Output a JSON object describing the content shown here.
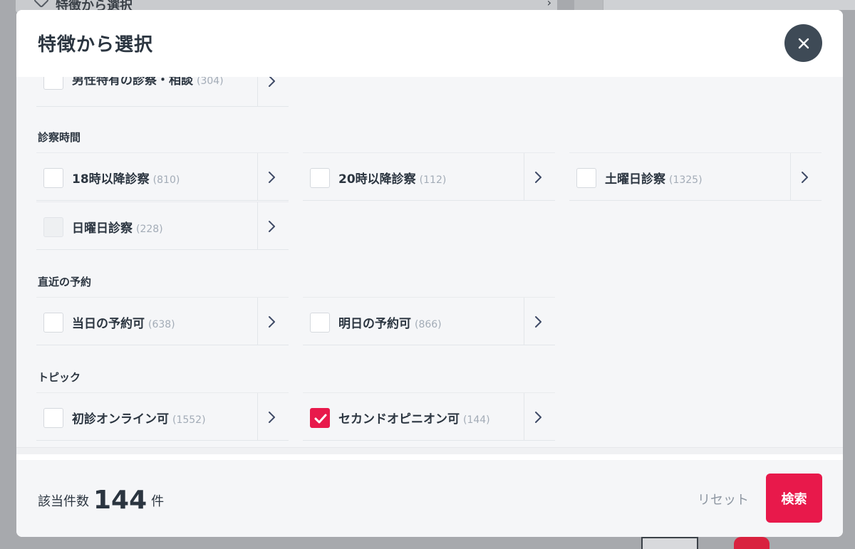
{
  "background": {
    "header_title": "特徴から選択"
  },
  "modal": {
    "title": "特徴から選択",
    "partial_option": {
      "label": "男性特有の診察・相談",
      "count": "(304)"
    },
    "sections": [
      {
        "title": "診察時間",
        "options": [
          {
            "label": "18時以降診察",
            "count": "(810)",
            "state": "unchecked"
          },
          {
            "label": "20時以降診察",
            "count": "(112)",
            "state": "unchecked"
          },
          {
            "label": "土曜日診察",
            "count": "(1325)",
            "state": "unchecked"
          },
          {
            "label": "日曜日診察",
            "count": "(228)",
            "state": "disabled"
          }
        ]
      },
      {
        "title": "直近の予約",
        "options": [
          {
            "label": "当日の予約可",
            "count": "(638)",
            "state": "unchecked"
          },
          {
            "label": "明日の予約可",
            "count": "(866)",
            "state": "unchecked"
          }
        ]
      },
      {
        "title": "トピック",
        "options": [
          {
            "label": "初診オンライン可",
            "count": "(1552)",
            "state": "unchecked"
          },
          {
            "label": "セカンドオピニオン可",
            "count": "(144)",
            "state": "checked"
          }
        ]
      }
    ],
    "footer": {
      "result_label": "該当件数",
      "result_number": "144",
      "result_unit": "件",
      "reset_label": "リセット",
      "search_label": "検索"
    }
  },
  "colors": {
    "accent": "#e8194b",
    "close_button_bg": "#3e4a56",
    "text": "#2b3540",
    "count_text": "#a3acb7"
  }
}
